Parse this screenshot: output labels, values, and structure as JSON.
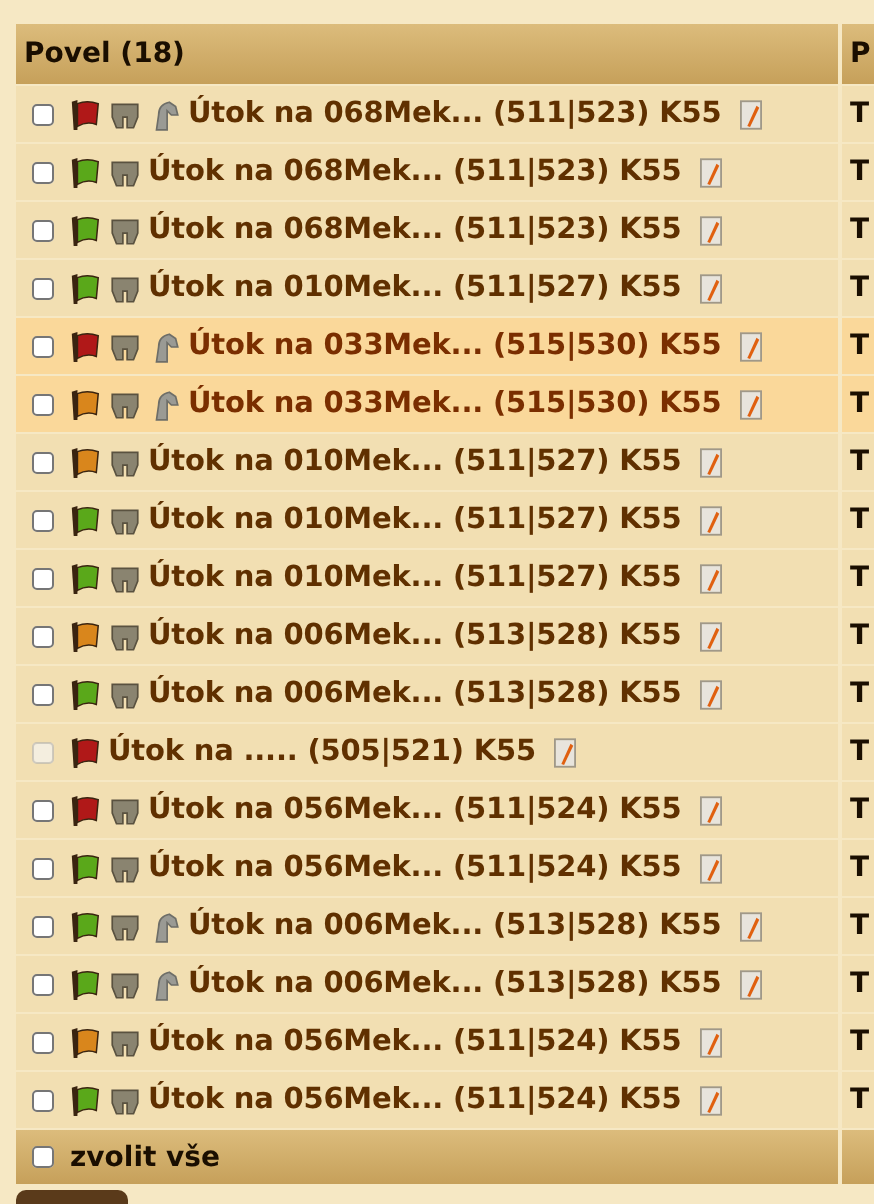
{
  "table": {
    "columns": [
      {
        "label": "Povel (18)"
      },
      {
        "label": "P"
      }
    ],
    "rows": [
      {
        "color": "#b01818",
        "ram": true,
        "horse": true,
        "highlighted": false,
        "disabled": false,
        "checked": false,
        "label": "Útok na 068Mek... (511|523) K55",
        "column_2": "T"
      },
      {
        "color": "#5aa81a",
        "ram": true,
        "horse": false,
        "highlighted": false,
        "disabled": false,
        "checked": false,
        "label": "Útok na 068Mek... (511|523) K55",
        "column_2": "T"
      },
      {
        "color": "#5aa81a",
        "ram": true,
        "horse": false,
        "highlighted": false,
        "disabled": false,
        "checked": false,
        "label": "Útok na 068Mek... (511|523) K55",
        "column_2": "T"
      },
      {
        "color": "#5aa81a",
        "ram": true,
        "horse": false,
        "highlighted": false,
        "disabled": false,
        "checked": false,
        "label": "Útok na 010Mek... (511|527) K55",
        "column_2": "T"
      },
      {
        "color": "#b01818",
        "ram": true,
        "horse": true,
        "highlighted": true,
        "disabled": false,
        "checked": false,
        "label": "Útok na 033Mek... (515|530) K55",
        "column_2": "T"
      },
      {
        "color": "#d9861c",
        "ram": true,
        "horse": true,
        "highlighted": true,
        "disabled": false,
        "checked": false,
        "label": "Útok na 033Mek... (515|530) K55",
        "column_2": "T"
      },
      {
        "color": "#d9861c",
        "ram": true,
        "horse": false,
        "highlighted": false,
        "disabled": false,
        "checked": false,
        "label": "Útok na 010Mek... (511|527) K55",
        "column_2": "T"
      },
      {
        "color": "#5aa81a",
        "ram": true,
        "horse": false,
        "highlighted": false,
        "disabled": false,
        "checked": false,
        "label": "Útok na 010Mek... (511|527) K55",
        "column_2": "T"
      },
      {
        "color": "#5aa81a",
        "ram": true,
        "horse": false,
        "highlighted": false,
        "disabled": false,
        "checked": false,
        "label": "Útok na 010Mek... (511|527) K55",
        "column_2": "T"
      },
      {
        "color": "#d9861c",
        "ram": true,
        "horse": false,
        "highlighted": false,
        "disabled": false,
        "checked": false,
        "label": "Útok na 006Mek... (513|528) K55",
        "column_2": "T"
      },
      {
        "color": "#5aa81a",
        "ram": true,
        "horse": false,
        "highlighted": false,
        "disabled": false,
        "checked": false,
        "label": "Útok na 006Mek... (513|528) K55",
        "column_2": "T"
      },
      {
        "color": "#b01818",
        "ram": false,
        "horse": false,
        "highlighted": false,
        "disabled": true,
        "checked": false,
        "label": "Útok na ..... (505|521) K55",
        "column_2": "T"
      },
      {
        "color": "#b01818",
        "ram": true,
        "horse": false,
        "highlighted": false,
        "disabled": false,
        "checked": false,
        "label": "Útok na 056Mek... (511|524) K55",
        "column_2": "T"
      },
      {
        "color": "#5aa81a",
        "ram": true,
        "horse": false,
        "highlighted": false,
        "disabled": false,
        "checked": false,
        "label": "Útok na 056Mek... (511|524) K55",
        "column_2": "T"
      },
      {
        "color": "#5aa81a",
        "ram": true,
        "horse": true,
        "highlighted": false,
        "disabled": false,
        "checked": false,
        "label": "Útok na 006Mek... (513|528) K55",
        "column_2": "T"
      },
      {
        "color": "#5aa81a",
        "ram": true,
        "horse": true,
        "highlighted": false,
        "disabled": false,
        "checked": false,
        "label": "Útok na 006Mek... (513|528) K55",
        "column_2": "T"
      },
      {
        "color": "#d9861c",
        "ram": true,
        "horse": false,
        "highlighted": false,
        "disabled": false,
        "checked": false,
        "label": "Útok na 056Mek... (511|524) K55",
        "column_2": "T"
      },
      {
        "color": "#5aa81a",
        "ram": true,
        "horse": false,
        "highlighted": false,
        "disabled": false,
        "checked": false,
        "label": "Útok na 056Mek... (511|524) K55",
        "column_2": "T"
      }
    ]
  },
  "select_all": {
    "label": "zvolit vše",
    "checked": false
  }
}
